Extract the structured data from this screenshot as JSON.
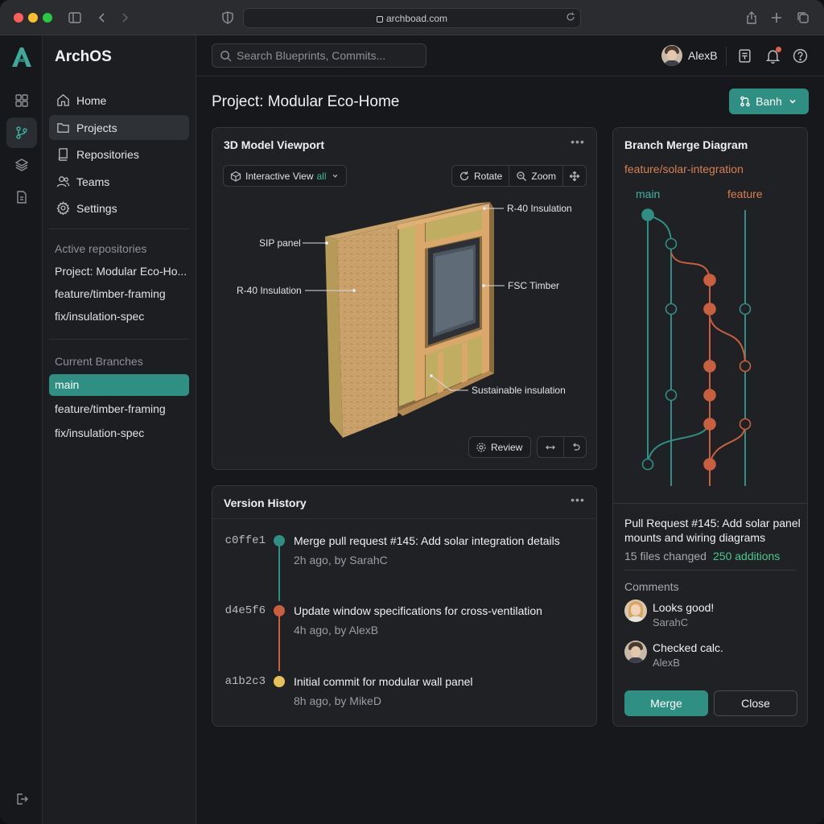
{
  "browser": {
    "url": "archboad.com"
  },
  "app": {
    "name": "ArchOS",
    "logo_letter": "A"
  },
  "sidebar": {
    "nav": [
      {
        "label": "Home",
        "icon": "home-icon"
      },
      {
        "label": "Projects",
        "icon": "folder-icon",
        "active": true
      },
      {
        "label": "Repositories",
        "icon": "book-icon"
      },
      {
        "label": "Teams",
        "icon": "users-icon"
      },
      {
        "label": "Settings",
        "icon": "gear-icon"
      }
    ],
    "active_repositories_title": "Active repositories",
    "active_repositories": [
      "Project: Modular Eco-Ho...",
      "feature/timber-framing",
      "fix/insulation-spec"
    ],
    "current_branches_title": "Current Branches",
    "current_branches": [
      "main",
      "feature/timber-framing",
      "fix/insulation-spec"
    ]
  },
  "topbar": {
    "search_placeholder": "Search Blueprints, Commits...",
    "username": "AlexB"
  },
  "page": {
    "title": "Project: Modular Eco-Home",
    "branch_button": "Banh"
  },
  "viewport": {
    "title": "3D Model Viewport",
    "view_select_label": "Interactive View",
    "view_select_value": "all",
    "rotate": "Rotate",
    "zoom": "Zoom",
    "review": "Review",
    "callouts": {
      "r40_top": "R-40 Insulation",
      "sip": "SIP panel",
      "r40_left": "R-40 Insulation",
      "fsc": "FSC Timber",
      "sustainable": "Sustainable insulation"
    }
  },
  "history": {
    "title": "Version History",
    "commits": [
      {
        "hash": "c0ffe1",
        "message": "Merge pull request #145: Add solar integration details",
        "meta": "2h ago, by SarahC",
        "color": "#2f8f83"
      },
      {
        "hash": "d4e5f6",
        "message": "Update window specifications for cross-ventilation",
        "meta": "4h ago, by AlexB",
        "color": "#c8603f"
      },
      {
        "hash": "a1b2c3",
        "message": "Initial commit for modular wall panel",
        "meta": "8h ago, by MikeD",
        "color": "#e6c15a"
      }
    ]
  },
  "merge": {
    "title": "Branch Merge Diagram",
    "branch": "feature/solar-integration",
    "lane_main": "main",
    "lane_feature": "feature",
    "pr_title_line1": "Pull Request #145: Add solar panel",
    "pr_title_line2": "mounts and wiring diagrams",
    "files_changed": "15 files changed",
    "additions": "250 additions",
    "comments_title": "Comments",
    "comments": [
      {
        "text": "Looks good!",
        "author": "SarahC"
      },
      {
        "text": "Checked calc.",
        "author": "AlexB"
      }
    ],
    "merge_button": "Merge",
    "close_button": "Close"
  },
  "colors": {
    "accent": "#2f8f83",
    "feature": "#c8603f",
    "yellow": "#e6c15a",
    "additions": "#49c98a"
  }
}
